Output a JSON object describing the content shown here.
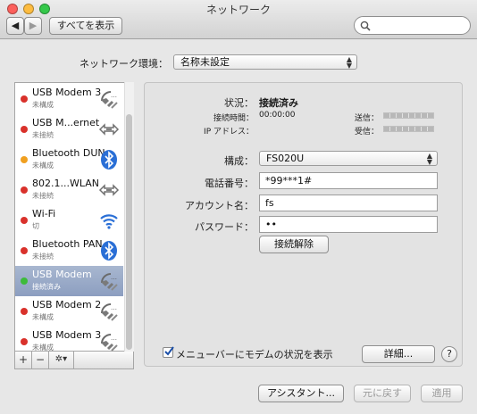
{
  "window": {
    "title": "ネットワーク",
    "show_all_label": "すべてを表示",
    "search_placeholder": ""
  },
  "location": {
    "label": "ネットワーク環境：",
    "value": "名称未設定"
  },
  "services": [
    {
      "name": "USB Modem 3",
      "status": "未構成",
      "dot_color": "#d9312b",
      "icon": "phone-modem-icon"
    },
    {
      "name": "USB M...ernet",
      "status": "未接続",
      "dot_color": "#d9312b",
      "icon": "ethernet-arrows-icon"
    },
    {
      "name": "Bluetooth DUN",
      "status": "未構成",
      "dot_color": "#f0a020",
      "icon": "bluetooth-icon"
    },
    {
      "name": "802.1...WLAN",
      "status": "未接続",
      "dot_color": "#d9312b",
      "icon": "ethernet-arrows-icon"
    },
    {
      "name": "Wi-Fi",
      "status": "切",
      "dot_color": "#d9312b",
      "icon": "wifi-icon"
    },
    {
      "name": "Bluetooth PAN",
      "status": "未接続",
      "dot_color": "#d9312b",
      "icon": "bluetooth-icon"
    },
    {
      "name": "USB Modem",
      "status": "接続済み",
      "dot_color": "#3dbb3a",
      "icon": "phone-modem-icon",
      "selected": true
    },
    {
      "name": "USB Modem 2",
      "status": "未構成",
      "dot_color": "#d9312b",
      "icon": "phone-modem-icon"
    },
    {
      "name": "USB Modem 3",
      "status": "未構成",
      "dot_color": "#d9312b",
      "icon": "phone-modem-icon"
    }
  ],
  "sidebar_buttons": {
    "add": "+",
    "remove": "−",
    "action": "✲▾"
  },
  "detail": {
    "status_label": "状況：",
    "status_value": "接続済み",
    "connect_time_label": "接続時間：",
    "connect_time_value": "00:00:00",
    "ip_label": "IP アドレス：",
    "sent_label": "送信：",
    "received_label": "受信：",
    "config_label": "構成：",
    "config_value": "FS020U",
    "phone_label": "電話番号：",
    "phone_value": "*99***1#",
    "account_label": "アカウント名：",
    "account_value": "fs",
    "password_label": "パスワード：",
    "password_value": "••",
    "disconnect_label": "接続解除",
    "show_status_label": "メニューバーにモデムの状況を表示",
    "show_status_checked": true,
    "advanced_label": "詳細...",
    "help_label": "?"
  },
  "footer": {
    "assistant_label": "アシスタント...",
    "revert_label": "元に戻す",
    "apply_label": "適用"
  },
  "colors": {
    "selection": "#8c9ec0",
    "bluetooth": "#2a6fd6",
    "wifi": "#2a6fd6"
  }
}
